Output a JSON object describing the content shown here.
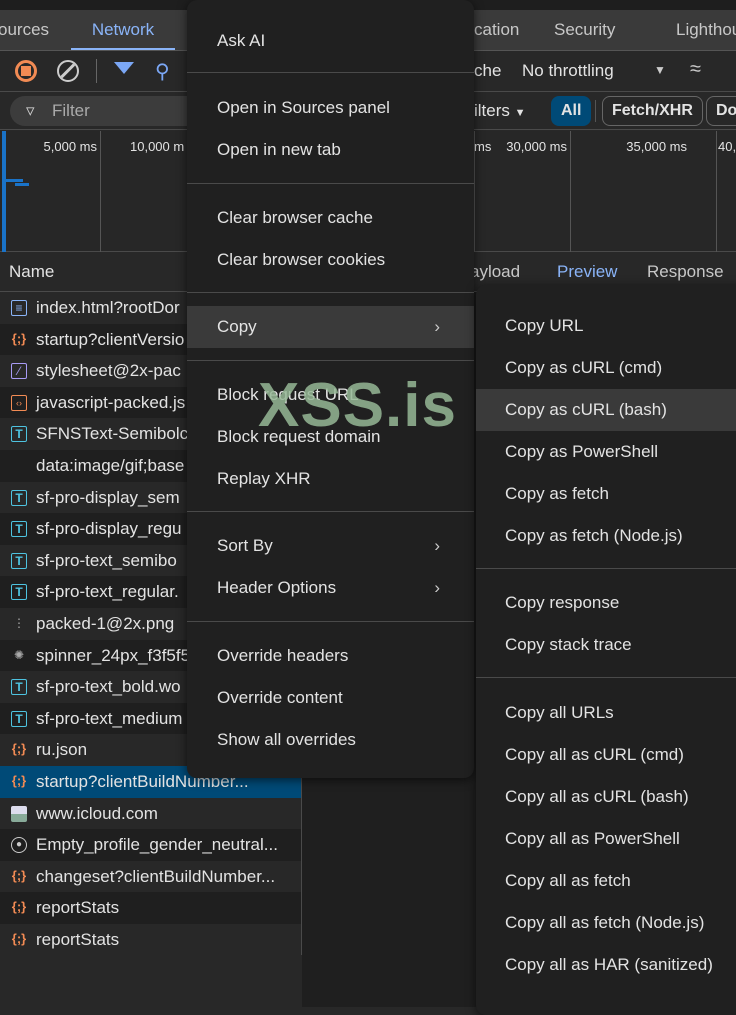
{
  "tabs": [
    {
      "label": "ources"
    },
    {
      "label": "Network",
      "active": true
    },
    {
      "label": "cation"
    },
    {
      "label": "Security"
    },
    {
      "label": "Lighthou"
    }
  ],
  "toolbar": {
    "cache_label": "che",
    "throttling": "No throttling"
  },
  "filter": {
    "placeholder": "Filter",
    "more_filters": "ilters",
    "chips": [
      "All",
      "Fetch/XHR",
      "Do"
    ]
  },
  "timeline": {
    "ticks": [
      "5,000 ms",
      "10,000 m",
      "ms",
      "30,000 ms",
      "35,000 ms",
      "40,"
    ]
  },
  "table": {
    "name_header": "Name",
    "detail_tabs": [
      "ayload",
      "Preview",
      "Response"
    ],
    "rows": [
      {
        "icon": "document-icon",
        "name": "index.html?rootDor"
      },
      {
        "icon": "json-icon",
        "name": "startup?clientVersio"
      },
      {
        "icon": "stylesheet-icon",
        "name": "stylesheet@2x-pac"
      },
      {
        "icon": "script-icon",
        "name": "javascript-packed.js"
      },
      {
        "icon": "font-icon",
        "name": "SFNSText-Semibolc"
      },
      {
        "icon": "",
        "name": "data:image/gif;base"
      },
      {
        "icon": "font-icon",
        "name": "sf-pro-display_sem"
      },
      {
        "icon": "font-icon",
        "name": "sf-pro-display_regu"
      },
      {
        "icon": "font-icon",
        "name": "sf-pro-text_semibo"
      },
      {
        "icon": "font-icon",
        "name": "sf-pro-text_regular."
      },
      {
        "icon": "image-dots-icon",
        "name": "packed-1@2x.png"
      },
      {
        "icon": "spinner-icon",
        "name": "spinner_24px_f3f5f5"
      },
      {
        "icon": "font-icon",
        "name": "sf-pro-text_bold.wo"
      },
      {
        "icon": "font-icon",
        "name": "sf-pro-text_medium"
      },
      {
        "icon": "json-icon",
        "name": "ru.json"
      },
      {
        "icon": "json-icon",
        "name": "startup?clientBuildNumber...",
        "selected": true
      },
      {
        "icon": "image-icon",
        "name": "www.icloud.com"
      },
      {
        "icon": "profile-icon",
        "name": "Empty_profile_gender_neutral..."
      },
      {
        "icon": "json-icon",
        "name": "changeset?clientBuildNumber..."
      },
      {
        "icon": "json-icon",
        "name": "reportStats"
      },
      {
        "icon": "json-icon",
        "name": "reportStats"
      }
    ]
  },
  "context_menu": {
    "items": [
      "Ask AI",
      "Open in Sources panel",
      "Open in new tab",
      "Clear browser cache",
      "Clear browser cookies",
      "Copy",
      "Block request URL",
      "Block request domain",
      "Replay XHR",
      "Sort By",
      "Header Options",
      "Override headers",
      "Override content",
      "Show all overrides"
    ]
  },
  "copy_submenu": {
    "items": [
      "Copy URL",
      "Copy as cURL (cmd)",
      "Copy as cURL (bash)",
      "Copy as PowerShell",
      "Copy as fetch",
      "Copy as fetch (Node.js)",
      "Copy response",
      "Copy stack trace",
      "Copy all URLs",
      "Copy all as cURL (cmd)",
      "Copy all as cURL (bash)",
      "Copy all as PowerShell",
      "Copy all as fetch",
      "Copy all as fetch (Node.js)",
      "Copy all as HAR (sanitized)"
    ],
    "highlighted": "Copy as cURL (bash)"
  },
  "watermark": "XSS.is",
  "colors": {
    "accent": "#8ab4f8",
    "selected_row": "#004a77",
    "record": "#f28b54"
  }
}
